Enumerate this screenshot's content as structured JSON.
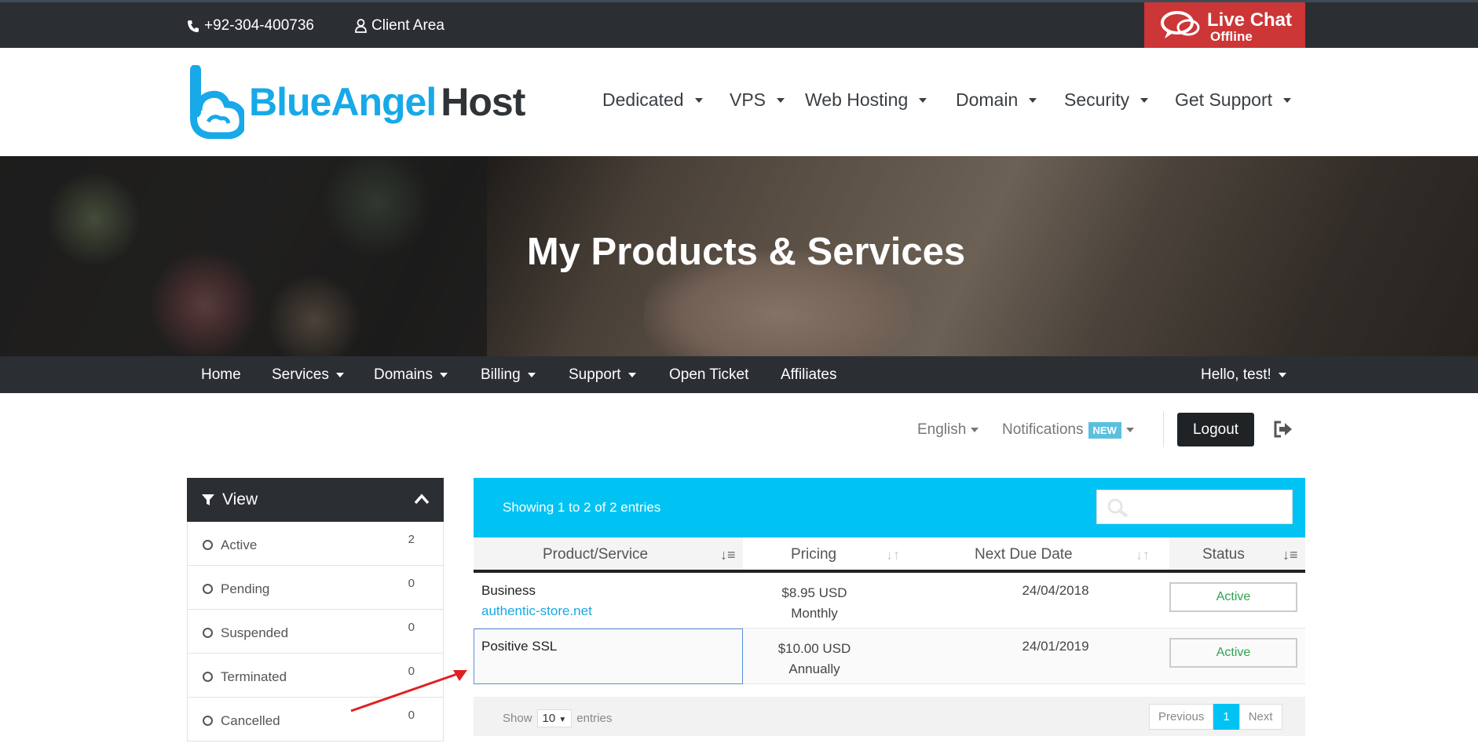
{
  "topbar": {
    "phone": "+92-304-400736",
    "client_area": "Client Area",
    "live_chat": "Live Chat",
    "live_chat_status": "Offline"
  },
  "logo": {
    "part1": "BlueAngel",
    "part2": "Host"
  },
  "main_nav": [
    "Dedicated",
    "VPS",
    "Web Hosting",
    "Domain",
    "Security",
    "Get Support"
  ],
  "hero": {
    "title": "My Products & Services"
  },
  "sub_nav": {
    "items": [
      "Home",
      "Services",
      "Domains",
      "Billing",
      "Support",
      "Open Ticket",
      "Affiliates"
    ],
    "greeting": "Hello, test!"
  },
  "util": {
    "language": "English",
    "notifications": "Notifications",
    "new_badge": "NEW",
    "logout": "Logout"
  },
  "sidebar": {
    "title": "View",
    "items": [
      {
        "label": "Active",
        "count": "2"
      },
      {
        "label": "Pending",
        "count": "0"
      },
      {
        "label": "Suspended",
        "count": "0"
      },
      {
        "label": "Terminated",
        "count": "0"
      },
      {
        "label": "Cancelled",
        "count": "0"
      }
    ]
  },
  "table": {
    "info": "Showing 1 to 2 of 2 entries",
    "columns": [
      "Product/Service",
      "Pricing",
      "Next Due Date",
      "Status"
    ],
    "rows": [
      {
        "product": "Business",
        "domain": "authentic-store.net",
        "price": "$8.95 USD",
        "cycle": "Monthly",
        "due": "24/04/2018",
        "status": "Active"
      },
      {
        "product": "Positive SSL",
        "domain": "",
        "price": "$10.00 USD",
        "cycle": "Annually",
        "due": "24/01/2019",
        "status": "Active"
      }
    ],
    "show_label": "Show",
    "page_size": "10",
    "entries_label": "entries",
    "pager": {
      "prev": "Previous",
      "current": "1",
      "next": "Next"
    }
  },
  "colors": {
    "accent": "#00c3f3",
    "dark": "#2b2f33",
    "chat": "#cc3637",
    "status_green": "#2ea44f"
  }
}
